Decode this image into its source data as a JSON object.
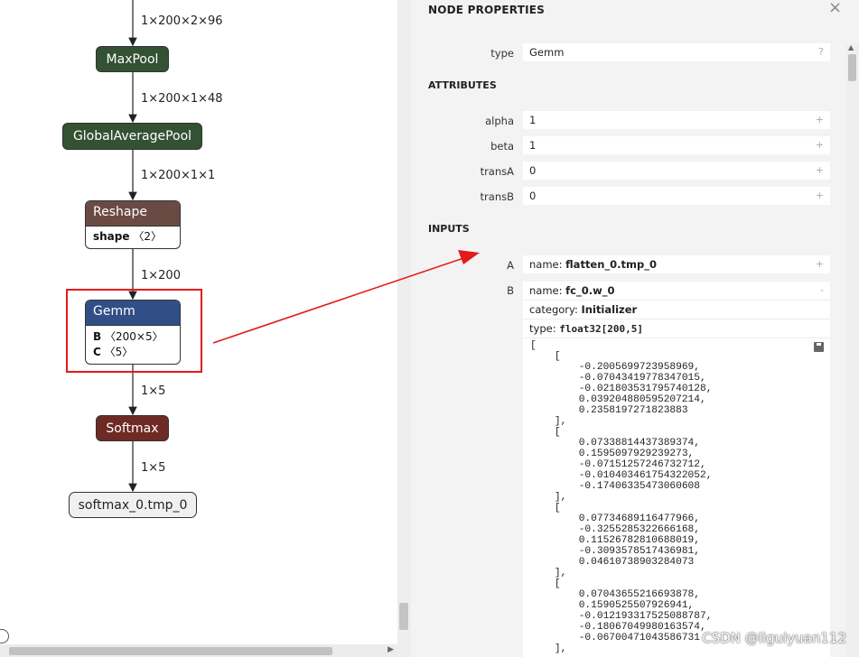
{
  "graph": {
    "edges": [
      "1×200×2×96",
      "1×200×1×48",
      "1×200×1×1",
      "1×200",
      "1×5",
      "1×5"
    ],
    "nodes": {
      "maxpool": "MaxPool",
      "gap": "GlobalAveragePool",
      "reshape": {
        "title": "Reshape",
        "attr_name": "shape",
        "attr_value": "〈2〉"
      },
      "gemm": {
        "title": "Gemm",
        "b_name": "B",
        "b_value": "〈200×5〉",
        "c_name": "C",
        "c_value": "〈5〉"
      },
      "softmax": "Softmax",
      "output": "softmax_0.tmp_0"
    }
  },
  "panel": {
    "title": "NODE PROPERTIES",
    "close": "×",
    "type_label": "type",
    "type_value": "Gemm",
    "type_help": "?",
    "attributes_title": "ATTRIBUTES",
    "attributes": [
      {
        "label": "alpha",
        "value": "1",
        "btn": "+"
      },
      {
        "label": "beta",
        "value": "1",
        "btn": "+"
      },
      {
        "label": "transA",
        "value": "0",
        "btn": "+"
      },
      {
        "label": "transB",
        "value": "0",
        "btn": "+"
      }
    ],
    "inputs_title": "INPUTS",
    "input_a": {
      "label": "A",
      "name_prefix": "name:",
      "name": "flatten_0.tmp_0",
      "btn": "+"
    },
    "input_b": {
      "label": "B",
      "name_prefix": "name:",
      "name": "fc_0.w_0",
      "btn": "-",
      "category_prefix": "category:",
      "category": "Initializer",
      "type_prefix": "type:",
      "type": "float32[200,5]",
      "tensor": "[\n    [\n        -0.2005699723958969,\n        -0.07043419778347015,\n        -0.021803531795740128,\n        0.039204880595207214,\n        0.2358197271823883\n    ],\n    [\n        0.07338814437389374,\n        0.1595097929239273,\n        -0.07151257246732712,\n        -0.010403461754322052,\n        -0.17406335473060608\n    ],\n    [\n        0.07734689116477966,\n        -0.3255285322666168,\n        0.11526782810688019,\n        -0.3093578517436981,\n        0.04610738903284073\n    ],\n    [\n        0.07043655216693878,\n        0.1590525507926941,\n        -0.012193317525088787,\n        -0.18067049980163574,\n        -0.06700471043586731\n    ],"
    }
  },
  "watermark": "CSDN @liguiyuan112",
  "colors": {
    "highlight": "#e31b1b",
    "gemm_header": "#2f4f86",
    "op_green": "#335133",
    "softmax": "#6e2a24",
    "reshape_header": "#6b4a44"
  }
}
